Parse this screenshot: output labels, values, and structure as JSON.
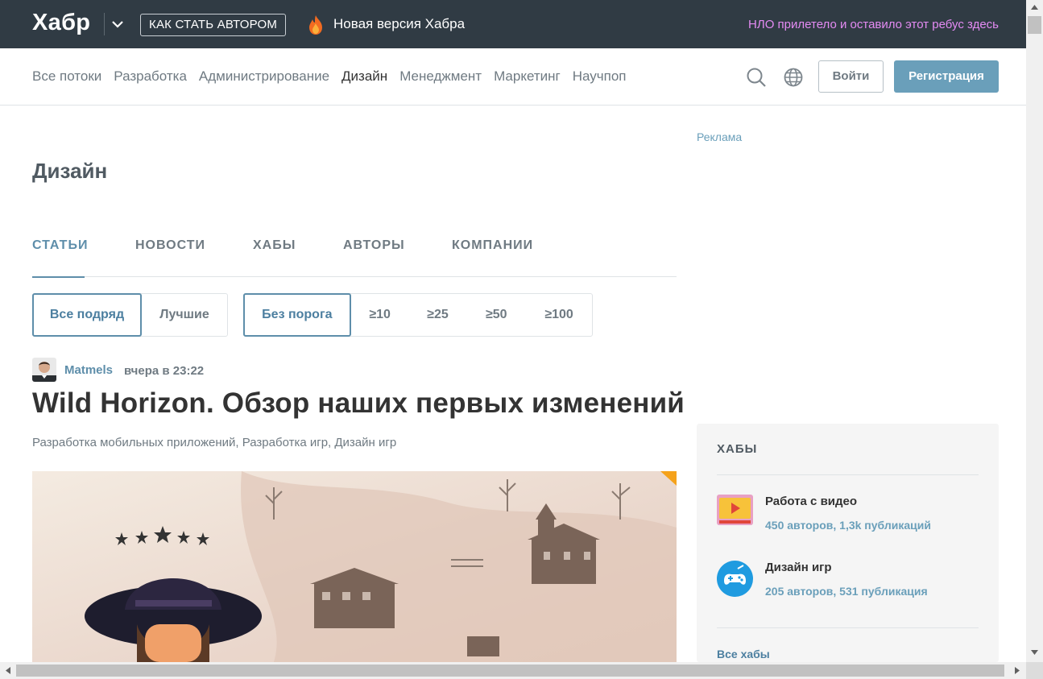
{
  "header": {
    "logo": "Хабр",
    "how_to_author": "КАК СТАТЬ АВТОРОМ",
    "new_version": "Новая версия Хабра",
    "ufo_text": "НЛО прилетело и оставило этот ребус здесь"
  },
  "nav": {
    "items": [
      "Все потоки",
      "Разработка",
      "Администрирование",
      "Дизайн",
      "Менеджмент",
      "Маркетинг",
      "Научпоп"
    ],
    "active": "Дизайн",
    "login": "Войти",
    "register": "Регистрация"
  },
  "page": {
    "title": "Дизайн",
    "tabs": [
      "СТАТЬИ",
      "НОВОСТИ",
      "ХАБЫ",
      "АВТОРЫ",
      "КОМПАНИИ"
    ],
    "active_tab": "СТАТЬИ",
    "filters_sort": [
      "Все подряд",
      "Лучшие"
    ],
    "filters_threshold": [
      "Без порога",
      "≥10",
      "≥25",
      "≥50",
      "≥100"
    ]
  },
  "post": {
    "author": "Matmels",
    "time": "вчера в 23:22",
    "title": "Wild Horizon. Обзор наших первых изменений",
    "hubs": "Разработка мобильных приложений,  Разработка игр,  Дизайн игр"
  },
  "sidebar": {
    "ad_label": "Реклама",
    "hubs_title": "ХАБЫ",
    "hubs": [
      {
        "name": "Работа с видео",
        "stats": "450 авторов, 1,3k публикаций",
        "icon": "video-hub-icon"
      },
      {
        "name": "Дизайн игр",
        "stats": "205 авторов, 531 публикация",
        "icon": "gamepad-hub-icon"
      }
    ],
    "all_hubs": "Все хабы"
  },
  "colors": {
    "topbar": "#303b44",
    "accent": "#5e8eaa",
    "register": "#6a9fba",
    "ufo": "#e48bf3"
  }
}
